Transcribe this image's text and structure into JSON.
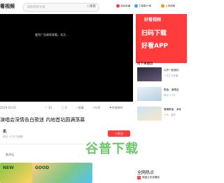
{
  "header": {
    "logo": "看视频",
    "search_placeholder": "搜索视频/作者",
    "search_button": "搜索",
    "items": [
      "我的收藏",
      "下载客户端",
      "上传视频"
    ]
  },
  "player": {
    "hint": "看完广告继续观看，关注..."
  },
  "video_meta": {
    "date": "2019-03-01",
    "likes": "30",
    "comments": "0",
    "collect": "收藏",
    "share": "分享",
    "report": "举报稿件"
  },
  "title": "演唱会深情告白歌迷 内地首站圆满落幕",
  "author": {
    "name": "讯",
    "desc": "粉丝 2.7万个视频",
    "follow": "+关注"
  },
  "comments_label": "条评论",
  "thumbs": [
    "NEW",
    "GOOD"
  ],
  "watermark": "谷普下载",
  "ad": {
    "brand": "好看视频",
    "line1": "扫码下载",
    "line2": "好看APP"
  },
  "sidebar": {
    "heading": "接下来播放",
    "items": [
      {
        "title": "以外一起相约",
        "sub": "一日之计在晨"
      },
      {
        "title": "歌曲：演唱会",
        "sub": "粉丝 2.7万"
      },
      {
        "title": "雪舞歌曲 · 深秋",
        "sub": "人气：新年"
      }
    ]
  },
  "hot": {
    "heading": "全网热点",
    "items": [
      "周国立机场着陆",
      "我爱家人共观国际"
    ]
  },
  "colors": {
    "accent": "#ff3b3b"
  }
}
